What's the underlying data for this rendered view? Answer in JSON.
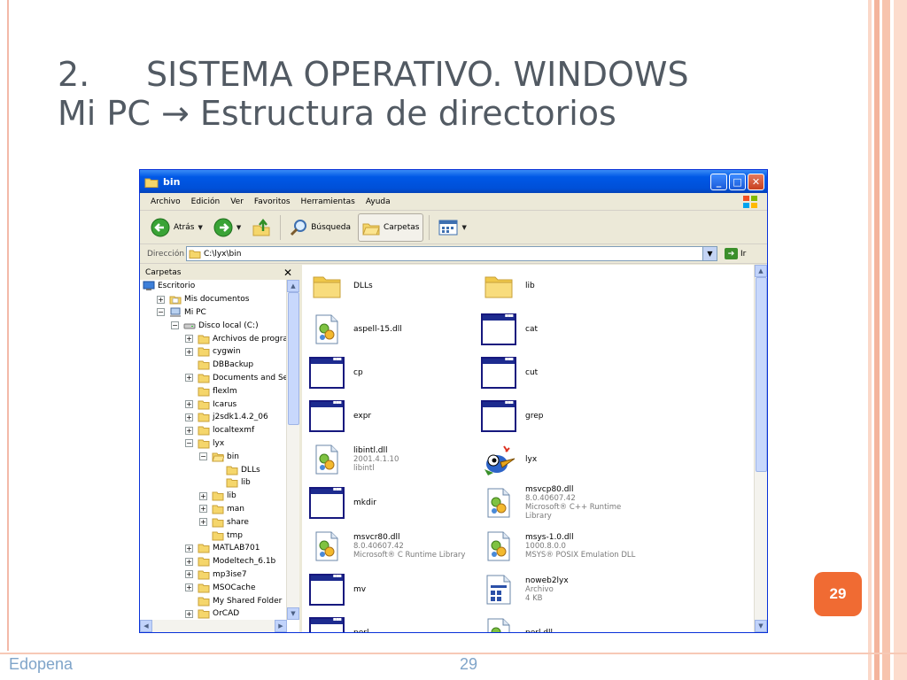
{
  "slide": {
    "title_num": "2.",
    "title_line1": "SISTEMA OPERATIVO. WINDOWS",
    "title_line2": "Mi PC → Estructura de directorios",
    "badge": "29",
    "footer_left": "Edopena",
    "footer_num": "29"
  },
  "colors": {
    "accent": "#f06b33",
    "xp_blue": "#0058e6",
    "folder": "#f5d66b",
    "footer_text": "#7fa4c9"
  },
  "window": {
    "title": "bin",
    "buttons": [
      "_",
      "□",
      "✕"
    ],
    "menu": [
      "Archivo",
      "Edición",
      "Ver",
      "Favoritos",
      "Herramientas",
      "Ayuda"
    ],
    "toolbar": {
      "back": "Atrás",
      "search": "Búsqueda",
      "folders": "Carpetas"
    },
    "address": {
      "label": "Dirección",
      "value": "C:\\lyx\\bin",
      "go": "Ir"
    },
    "panel_title": "Carpetas",
    "panel_close": "✕",
    "tree": [
      {
        "label": "Escritorio",
        "level": 0,
        "exp": "",
        "icon": "desktop-icon"
      },
      {
        "label": "Mis documentos",
        "level": 1,
        "exp": "+",
        "icon": "my-documents-icon"
      },
      {
        "label": "Mi PC",
        "level": 1,
        "exp": "−",
        "icon": "my-computer-icon"
      },
      {
        "label": "Disco local (C:)",
        "level": 2,
        "exp": "−",
        "icon": "drive-icon"
      },
      {
        "label": "Archivos de programa",
        "level": 3,
        "exp": "+",
        "icon": "folder-icon"
      },
      {
        "label": "cygwin",
        "level": 3,
        "exp": "+",
        "icon": "folder-icon"
      },
      {
        "label": "DBBackup",
        "level": 3,
        "exp": "",
        "icon": "folder-icon"
      },
      {
        "label": "Documents and Settings",
        "level": 3,
        "exp": "+",
        "icon": "folder-icon"
      },
      {
        "label": "flexlm",
        "level": 3,
        "exp": "",
        "icon": "folder-icon"
      },
      {
        "label": "Icarus",
        "level": 3,
        "exp": "+",
        "icon": "folder-icon"
      },
      {
        "label": "j2sdk1.4.2_06",
        "level": 3,
        "exp": "+",
        "icon": "folder-icon"
      },
      {
        "label": "localtexmf",
        "level": 3,
        "exp": "+",
        "icon": "folder-icon"
      },
      {
        "label": "lyx",
        "level": 3,
        "exp": "−",
        "icon": "folder-icon"
      },
      {
        "label": "bin",
        "level": 4,
        "exp": "−",
        "icon": "folder-open-icon"
      },
      {
        "label": "DLLs",
        "level": 5,
        "exp": "",
        "icon": "folder-icon"
      },
      {
        "label": "lib",
        "level": 5,
        "exp": "",
        "icon": "folder-icon"
      },
      {
        "label": "lib",
        "level": 4,
        "exp": "+",
        "icon": "folder-icon"
      },
      {
        "label": "man",
        "level": 4,
        "exp": "+",
        "icon": "folder-icon"
      },
      {
        "label": "share",
        "level": 4,
        "exp": "+",
        "icon": "folder-icon"
      },
      {
        "label": "tmp",
        "level": 4,
        "exp": "",
        "icon": "folder-icon"
      },
      {
        "label": "MATLAB701",
        "level": 3,
        "exp": "+",
        "icon": "folder-icon"
      },
      {
        "label": "Modeltech_6.1b",
        "level": 3,
        "exp": "+",
        "icon": "folder-icon"
      },
      {
        "label": "mp3ise7",
        "level": 3,
        "exp": "+",
        "icon": "folder-icon"
      },
      {
        "label": "MSOCache",
        "level": 3,
        "exp": "+",
        "icon": "folder-icon"
      },
      {
        "label": "My Shared Folder",
        "level": 3,
        "exp": "",
        "icon": "folder-icon"
      },
      {
        "label": "OrCAD",
        "level": 3,
        "exp": "+",
        "icon": "folder-icon"
      }
    ],
    "files": [
      {
        "name": "DLLs",
        "meta": [],
        "type": "folder"
      },
      {
        "name": "lib",
        "meta": [],
        "type": "folder"
      },
      {
        "name": "aspell-15.dll",
        "meta": [],
        "type": "dll"
      },
      {
        "name": "cat",
        "meta": [],
        "type": "exe"
      },
      {
        "name": "cp",
        "meta": [],
        "type": "exe"
      },
      {
        "name": "cut",
        "meta": [],
        "type": "exe"
      },
      {
        "name": "expr",
        "meta": [],
        "type": "exe"
      },
      {
        "name": "grep",
        "meta": [],
        "type": "exe"
      },
      {
        "name": "libintl.dll",
        "meta": [
          "2001.4.1.10",
          "libintl"
        ],
        "type": "dll"
      },
      {
        "name": "lyx",
        "meta": [],
        "type": "lyx"
      },
      {
        "name": "mkdir",
        "meta": [],
        "type": "exe"
      },
      {
        "name": "msvcp80.dll",
        "meta": [
          "8.0.40607.42",
          "Microsoft® C++ Runtime Library"
        ],
        "type": "dll"
      },
      {
        "name": "msvcr80.dll",
        "meta": [
          "8.0.40607.42",
          "Microsoft® C Runtime Library"
        ],
        "type": "dll"
      },
      {
        "name": "msys-1.0.dll",
        "meta": [
          "1000.8.0.0",
          "MSYS® POSIX Emulation DLL"
        ],
        "type": "dll"
      },
      {
        "name": "mv",
        "meta": [],
        "type": "exe"
      },
      {
        "name": "noweb2lyx",
        "meta": [
          "Archivo",
          "4 KB"
        ],
        "type": "doc"
      },
      {
        "name": "perl",
        "meta": [],
        "type": "exe"
      },
      {
        "name": "perl.dll",
        "meta": [],
        "type": "dll"
      }
    ]
  }
}
